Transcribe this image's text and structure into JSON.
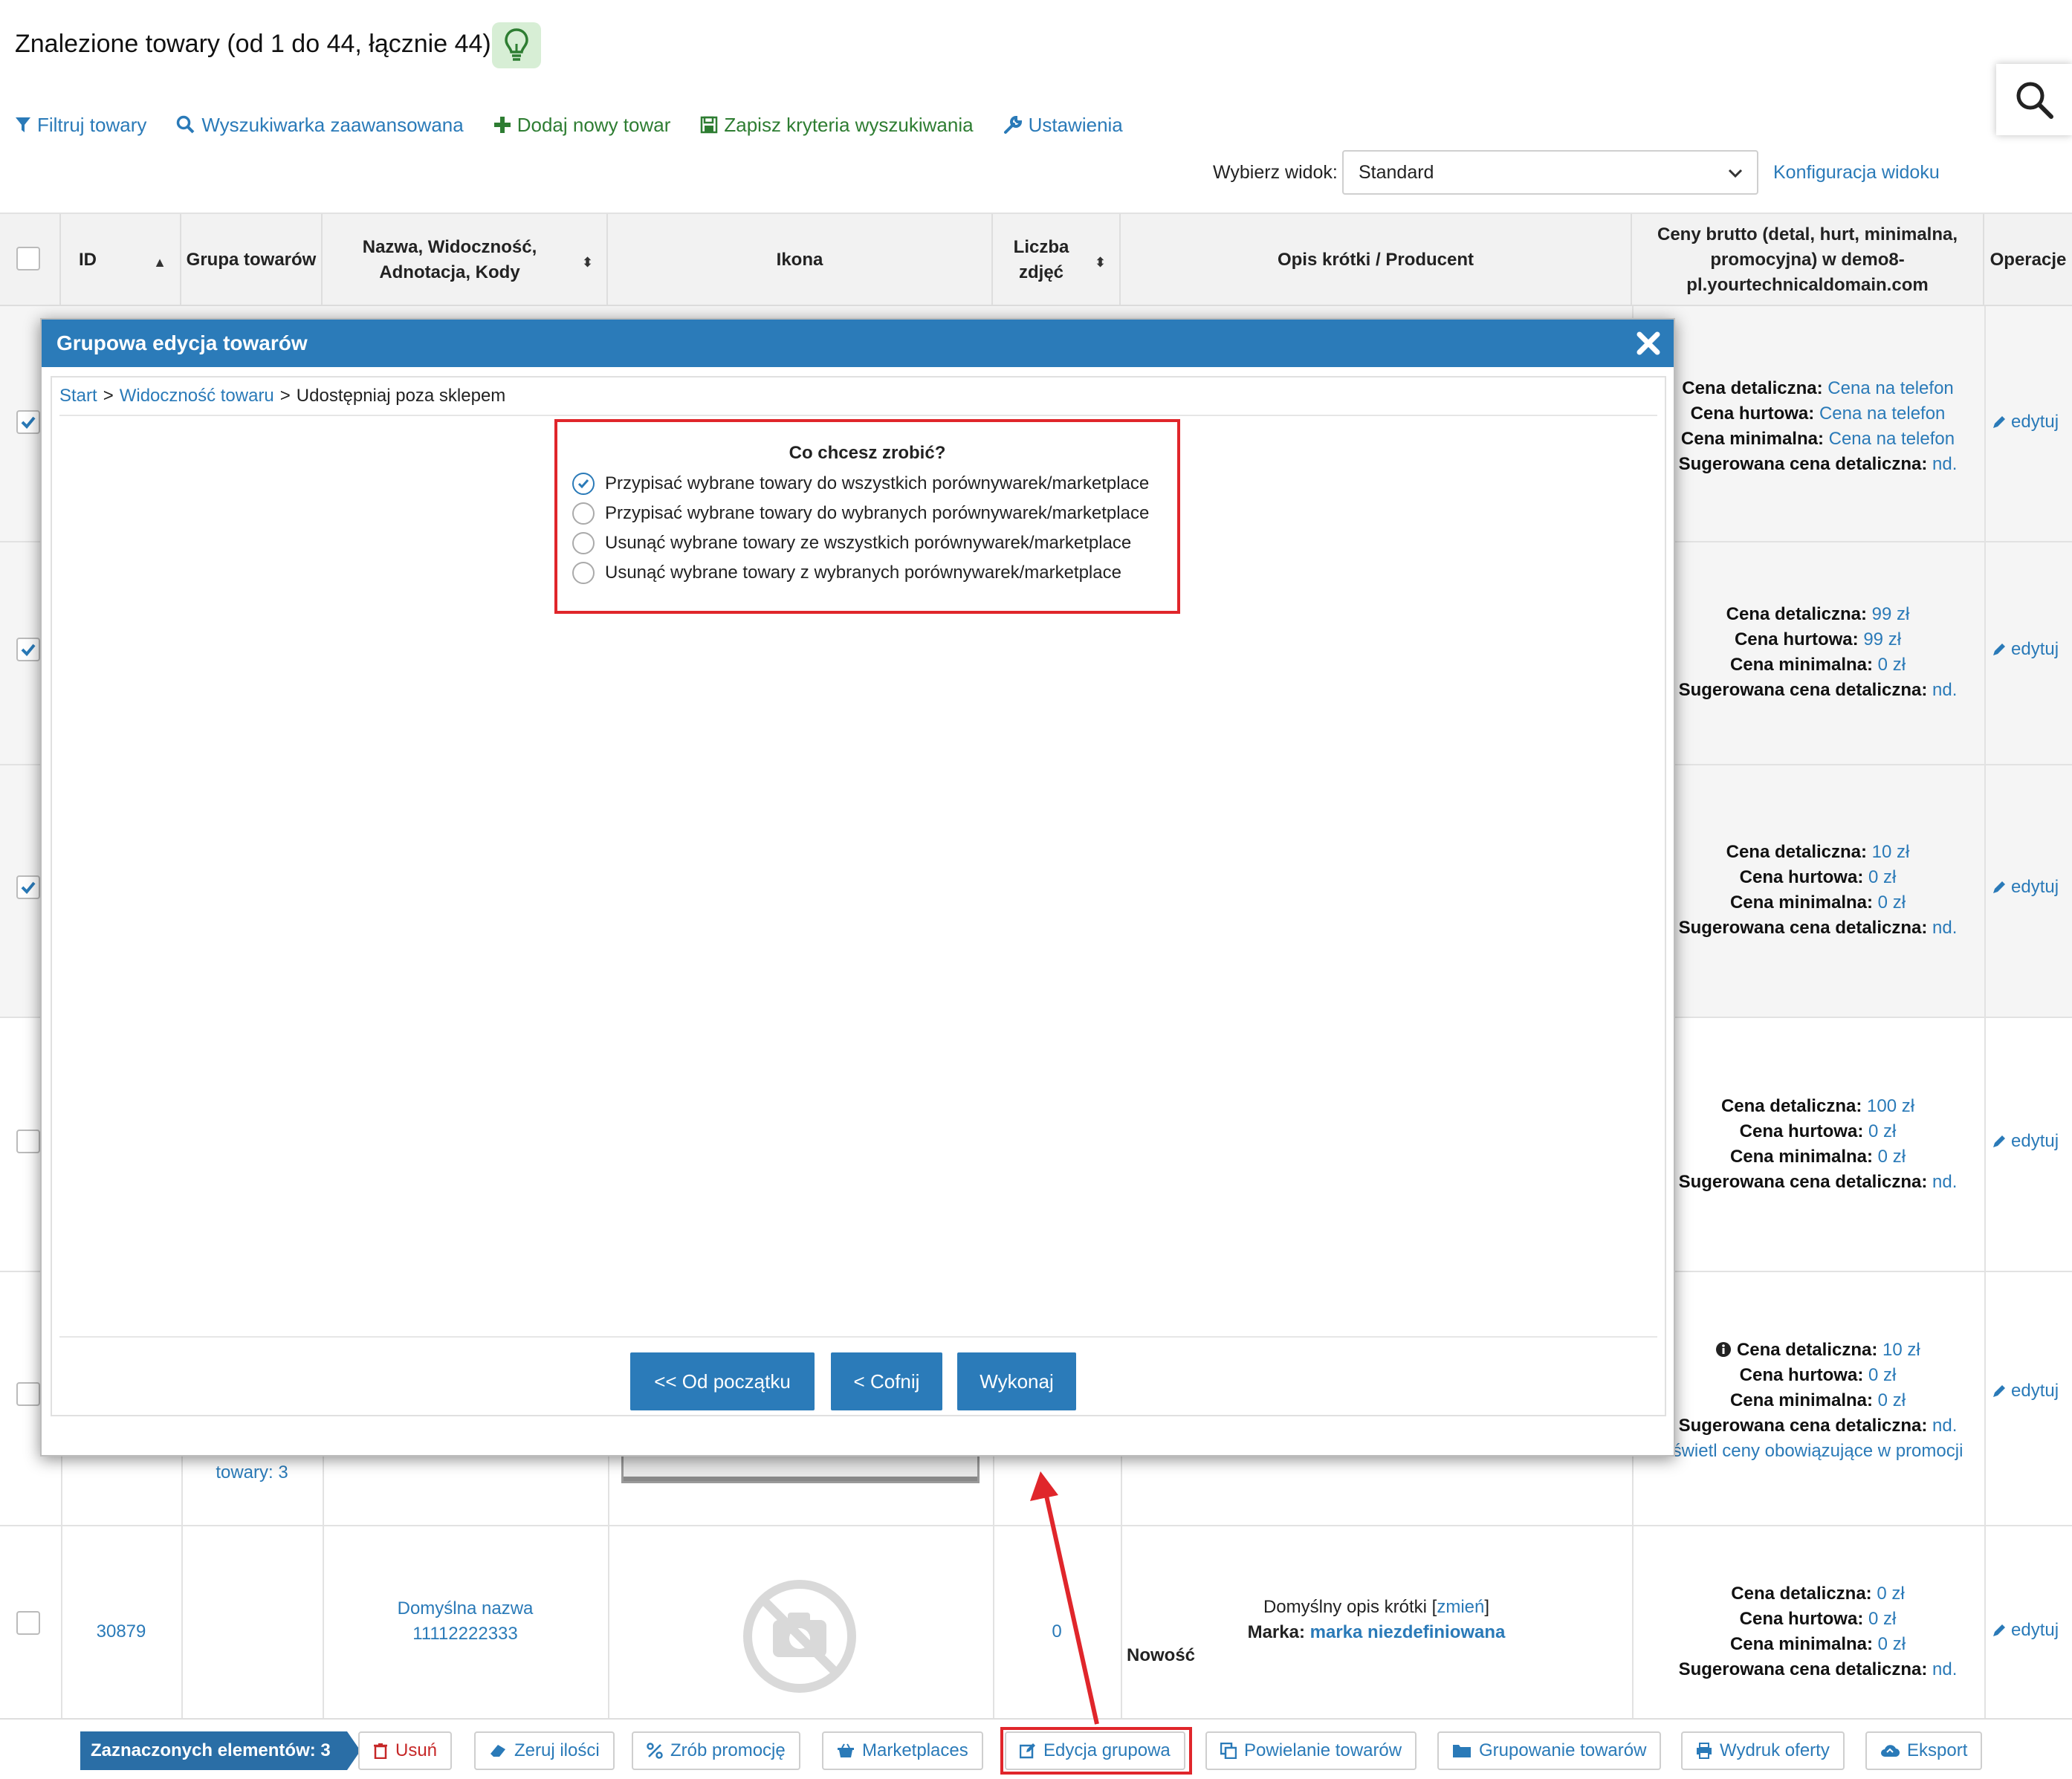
{
  "header": {
    "title": "Znalezione towary (od 1 do 44, łącznie 44)",
    "toolbar": [
      {
        "label": "Filtruj towary",
        "icon": "filter-icon"
      },
      {
        "label": "Wyszukiwarka zaawansowana",
        "icon": "search-icon"
      },
      {
        "label": "Dodaj nowy towar",
        "icon": "plus-icon"
      },
      {
        "label": "Zapisz kryteria wyszukiwania",
        "icon": "save-icon"
      },
      {
        "label": "Ustawienia",
        "icon": "wrench-icon"
      }
    ],
    "view_label": "Wybierz widok:",
    "view_value": "Standard",
    "view_config": "Konfiguracja widoku"
  },
  "table": {
    "columns": [
      "ID",
      "Grupa towarów",
      "Nazwa, Widoczność, Adnotacja, Kody",
      "Ikona",
      "Liczba zdjęć",
      "Opis krótki / Producent",
      "Ceny brutto (detal, hurt, minimalna, promocyjna) w demo8-pl.yourtechnicaldomain.com",
      "Operacje"
    ],
    "price_labels": {
      "retail": "Cena detaliczna:",
      "wholesale": "Cena hurtowa:",
      "minimal": "Cena minimalna:",
      "suggested": "Sugerowana cena detaliczna:"
    },
    "edit_label": "edytuj",
    "rows": [
      {
        "checked": true,
        "retail": "Cena na telefon",
        "wholesale": "Cena na telefon",
        "minimal": "Cena na telefon",
        "suggested": "nd."
      },
      {
        "checked": true,
        "retail": "99 zł",
        "wholesale": "99 zł",
        "minimal": "0 zł",
        "suggested": "nd."
      },
      {
        "checked": true,
        "retail": "10 zł",
        "wholesale": "0 zł",
        "minimal": "0 zł",
        "suggested": "nd."
      },
      {
        "checked": false,
        "retail": "100 zł",
        "wholesale": "0 zł",
        "minimal": "0 zł",
        "suggested": "nd."
      },
      {
        "checked": false,
        "retail": "10 zł",
        "wholesale": "0 zł",
        "minimal": "0 zł",
        "suggested": "nd.",
        "group_fragment": "towary: 3",
        "promo_link": "świetl ceny obowiązujące w promocji"
      },
      {
        "checked": false,
        "id": "30879",
        "name": "Domyślna nazwa",
        "code": "11112222333",
        "photos": "0",
        "desc": "Domyślny opis krótki",
        "desc_change": "zmień",
        "brand_label": "Marka:",
        "brand": "marka niezdefiniowana",
        "tag": "Nowość",
        "retail": "0 zł",
        "wholesale": "0 zł",
        "minimal": "0 zł",
        "suggested": "nd."
      }
    ]
  },
  "bottom_bar": {
    "selected": "Zaznaczonych elementów: 3",
    "actions": [
      "Usuń",
      "Zeruj ilości",
      "Zrób promocję",
      "Marketplaces",
      "Edycja grupowa",
      "Powielanie towarów",
      "Grupowanie towarów",
      "Wydruk oferty",
      "Eksport"
    ]
  },
  "modal": {
    "title": "Grupowa edycja towarów",
    "breadcrumb": [
      "Start",
      "Widoczność towaru",
      "Udostępniaj poza sklepem"
    ],
    "question": "Co chcesz zrobić?",
    "options": [
      "Przypisać wybrane towary do wszystkich porównywarek/marketplace",
      "Przypisać wybrane towary do wybranych porównywarek/marketplace",
      "Usunąć wybrane towary ze wszystkich porównywarek/marketplace",
      "Usunąć wybrane towary z wybranych porównywarek/marketplace"
    ],
    "selected_option": 0,
    "buttons": [
      "<< Od początku",
      "< Cofnij",
      "Wykonaj"
    ]
  },
  "colors": {
    "accent": "#2b7bb9",
    "link": "#2a7ab8",
    "highlight": "#e0262b",
    "green": "#2e7d32"
  }
}
